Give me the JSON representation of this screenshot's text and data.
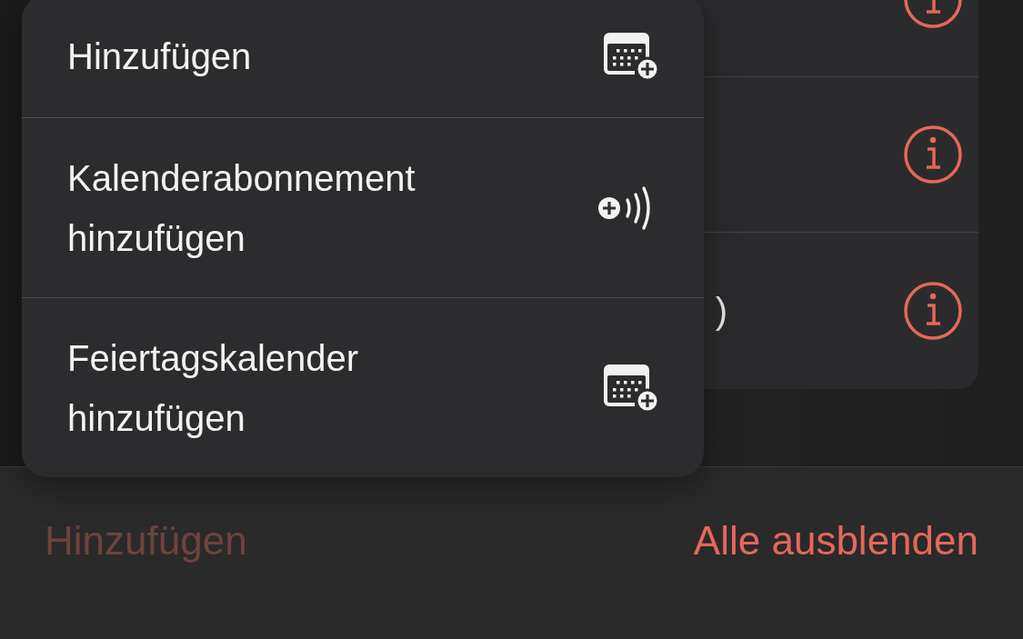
{
  "calendar_list": {
    "rows": [
      {
        "kind": "info-row"
      },
      {
        "kind": "info-row"
      },
      {
        "kind": "info-row",
        "label": ")"
      }
    ]
  },
  "context_menu": {
    "items": [
      {
        "label": "Hinzufügen",
        "kind": "calendar-add"
      },
      {
        "label": "Kalenderabonnement hinzufügen",
        "kind": "subscription"
      },
      {
        "label": "Feiertagskalender hinzufügen",
        "kind": "calendar-add"
      }
    ]
  },
  "toolbar": {
    "buttons": [
      {
        "label": "Hinzufügen",
        "disabled": true
      },
      {
        "label": "Alle ausblenden",
        "disabled": false
      }
    ]
  }
}
